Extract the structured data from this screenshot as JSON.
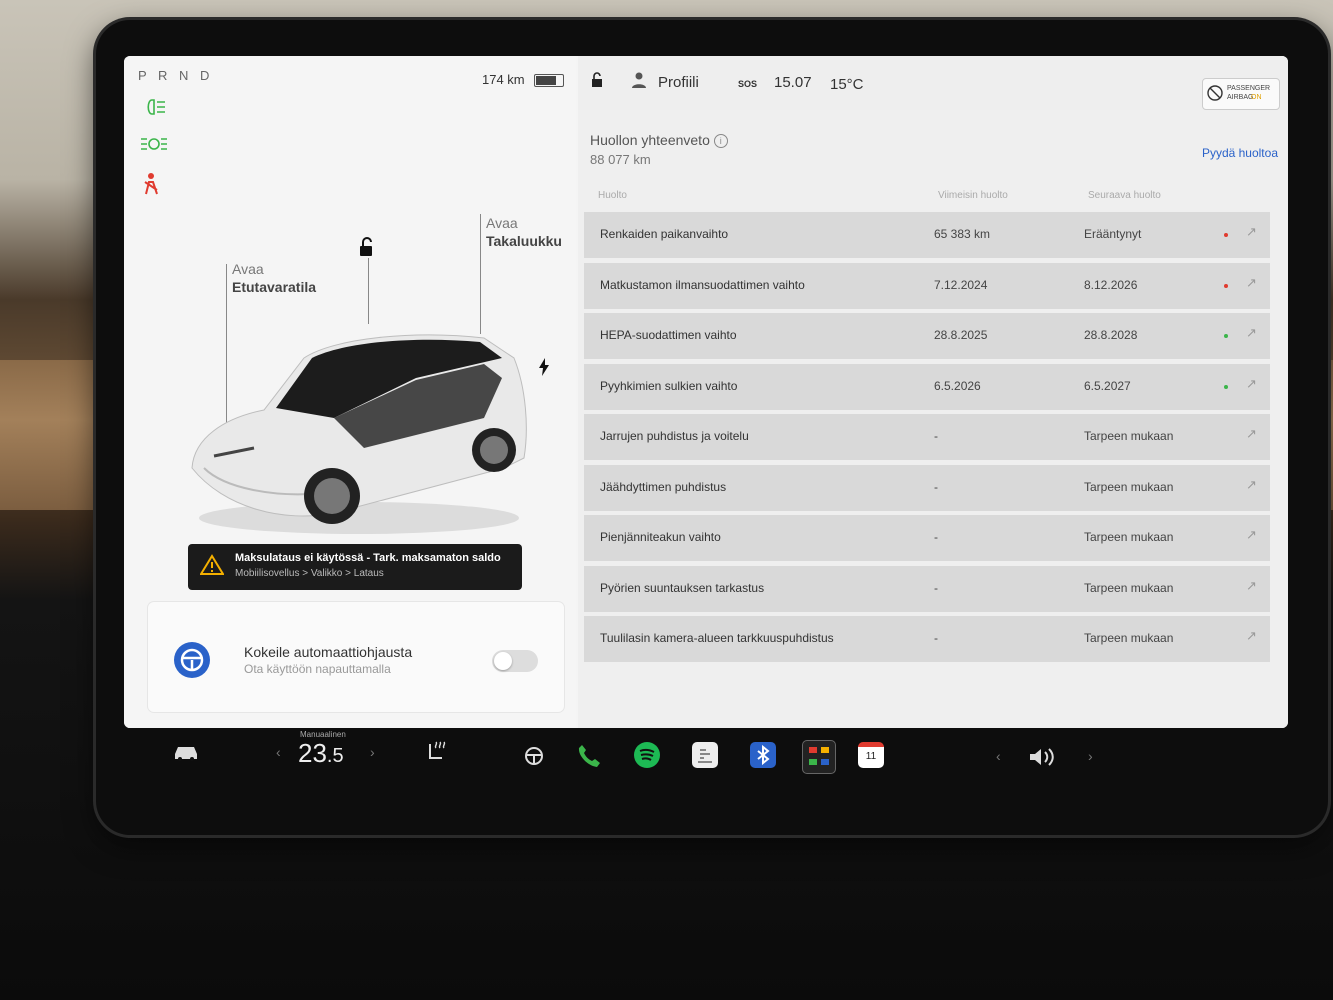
{
  "status": {
    "gear": "P R N D",
    "range": "174 km",
    "battery_level": 0.75,
    "profile": "Profiili",
    "sos": "SOS",
    "time": "15.07",
    "temperature": "15°C",
    "airbag_line1": "PASSENGER",
    "airbag_line2": "AIRBAG",
    "airbag_state": "ON"
  },
  "vehicle": {
    "frunk_action": "Avaa",
    "frunk_label": "Etutavaratila",
    "trunk_action": "Avaa",
    "trunk_label": "Takaluukku"
  },
  "alert": {
    "title": "Maksulataus ei käytössä - Tark. maksamaton saldo",
    "path": "Mobiilisovellus > Valikko > Lataus"
  },
  "autopilot": {
    "title": "Kokeile automaattiohjausta",
    "subtitle": "Ota käyttöön napauttamalla",
    "enabled": false
  },
  "service": {
    "title": "Huollon yhteenveto",
    "odometer": "88 077  km",
    "request_button": "Pyydä huoltoa",
    "col_service": "Huolto",
    "col_last": "Viimeisin huolto",
    "col_next": "Seuraava huolto",
    "rows": [
      {
        "name": "Renkaiden paikanvaihto",
        "last": "65 383 km",
        "next": "Erääntynyt",
        "status": "red"
      },
      {
        "name": "Matkustamon ilmansuodattimen vaihto",
        "last": "7.12.2024",
        "next": "8.12.2026",
        "status": "red"
      },
      {
        "name": "HEPA-suodattimen vaihto",
        "last": "28.8.2025",
        "next": "28.8.2028",
        "status": "green"
      },
      {
        "name": "Pyyhkimien sulkien vaihto",
        "last": "6.5.2026",
        "next": "6.5.2027",
        "status": "green"
      },
      {
        "name": "Jarrujen puhdistus ja voitelu",
        "last": "-",
        "next": "Tarpeen mukaan",
        "status": "none"
      },
      {
        "name": "Jäähdyttimen puhdistus",
        "last": "-",
        "next": "Tarpeen mukaan",
        "status": "none"
      },
      {
        "name": "Pienjänniteakun vaihto",
        "last": "-",
        "next": "Tarpeen mukaan",
        "status": "none"
      },
      {
        "name": "Pyörien suuntauksen tarkastus",
        "last": "-",
        "next": "Tarpeen mukaan",
        "status": "none"
      },
      {
        "name": "Tuulilasin kamera-alueen tarkkuuspuhdistus",
        "last": "-",
        "next": "Tarpeen mukaan",
        "status": "none"
      }
    ]
  },
  "dock": {
    "climate_mode": "Manuaalinen",
    "temp_whole": "23",
    "temp_decimal": ".5",
    "calendar_day": "11"
  },
  "colors": {
    "red": "#e03b2f",
    "green": "#3bb54a",
    "accent": "#2a62c9"
  }
}
